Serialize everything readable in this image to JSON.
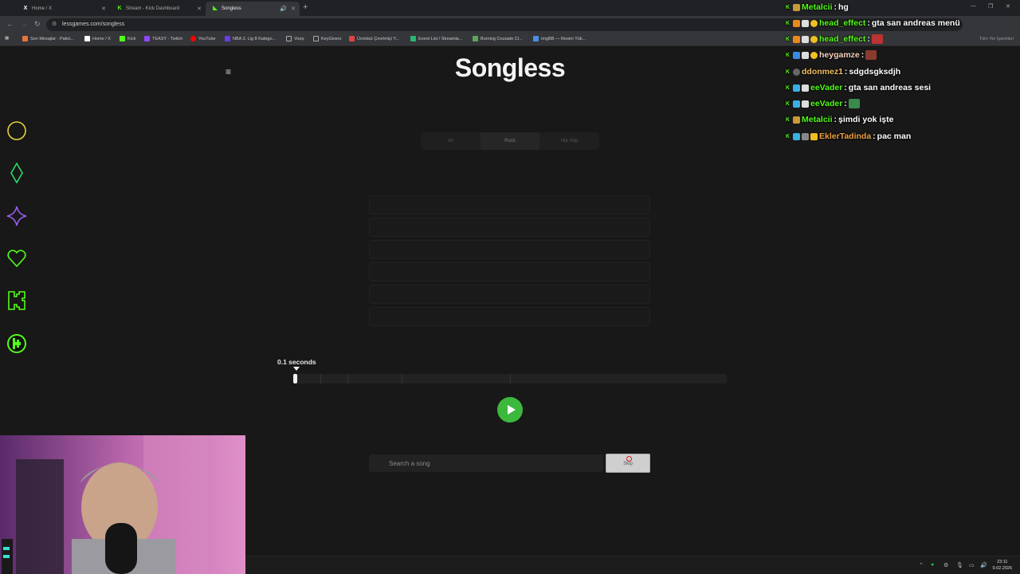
{
  "browser": {
    "tabs": [
      {
        "label": "Home / X",
        "icon": "x-icon"
      },
      {
        "label": "Stream - Kick Dashboard",
        "icon": "kick-icon"
      },
      {
        "label": "Songless",
        "icon": "songless-icon",
        "active": true
      }
    ],
    "url": "lessgames.com/songless",
    "bookmarks": [
      {
        "label": "Son Mesajlar - Patici...",
        "color": "#e8743b"
      },
      {
        "label": "Home / X",
        "color": "#ffffff"
      },
      {
        "label": "Kick",
        "color": "#53fc18"
      },
      {
        "label": "TEASY - Twitch",
        "color": "#9146ff"
      },
      {
        "label": "YouTube",
        "color": "#ff0000"
      },
      {
        "label": "NBA 3. Lig 8 Katego...",
        "color": "#6a3de8"
      },
      {
        "label": "Voep",
        "color": "#888888"
      },
      {
        "label": "KeyGivers",
        "color": "#888888"
      },
      {
        "label": "Ücretsiz Çevrimiçi Y...",
        "color": "#d44"
      },
      {
        "label": "Event List / Streamla...",
        "color": "#2bb673"
      },
      {
        "label": "Burning Crusade Cl...",
        "color": "#5aa55a"
      },
      {
        "label": "ImgBB — Resim Yük...",
        "color": "#4a90e2"
      }
    ],
    "all_bookmarks": "Tüm Yer İşaretleri"
  },
  "page": {
    "logo": "Songless",
    "genres": [
      {
        "label": "All"
      },
      {
        "label": "Rock",
        "active": true
      },
      {
        "label": "Hip Hop"
      }
    ],
    "guess_slots": 6,
    "seconds_label": "0.1 seconds",
    "progress_fraction": 0.01,
    "segment_fractions": [
      0.0625,
      0.125,
      0.25,
      0.5
    ],
    "search": {
      "placeholder": "Search a song"
    },
    "skip_label": "Skip"
  },
  "chat": [
    {
      "user": "Metalcii",
      "text": "hg",
      "user_color": "#53fc18"
    },
    {
      "user": "head_effect",
      "text": "gta san andreas menü",
      "user_color": "#53fc18"
    },
    {
      "user": "head_effect",
      "text": "",
      "user_color": "#53fc18",
      "emote": "#b33"
    },
    {
      "user": "heygamze",
      "text": "",
      "user_color": "#f5d0c0",
      "emote": "#8a3b2e"
    },
    {
      "user": "ddonmez1",
      "text": "sdgdsgksdjh",
      "user_color": "#f0c060"
    },
    {
      "user": "eeVader",
      "text": "gta san andreas sesi",
      "user_color": "#53fc18"
    },
    {
      "user": "eeVader",
      "text": "",
      "user_color": "#53fc18",
      "emote": "#3a8a4a"
    },
    {
      "user": "Metalcii",
      "text": "şimdi yok işte",
      "user_color": "#53fc18"
    },
    {
      "user": "EklerTadinda",
      "text": "pac man",
      "user_color": "#f0a040"
    }
  ],
  "taskbar": {
    "time": "23:11",
    "date": "9.02.2026"
  },
  "colors": {
    "accent_green": "#3cb83c",
    "overlay_yellow": "#e6d23a",
    "overlay_green": "#2bd96a",
    "overlay_purple": "#9b5cf0",
    "kick_green": "#53fc18"
  }
}
